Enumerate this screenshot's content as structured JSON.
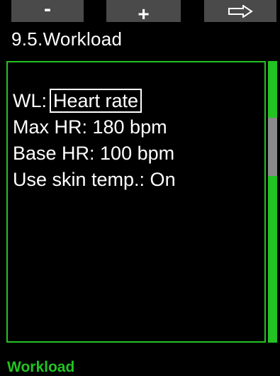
{
  "softkeys": {
    "minus_label": "-",
    "plus_label": "+",
    "next_icon": "arrow-right-icon"
  },
  "header": {
    "title": "9.5.Workload"
  },
  "settings": {
    "wl_label": "WL:",
    "wl_value": "Heart rate",
    "max_hr": "Max HR: 180 bpm",
    "base_hr": "Base HR: 100 bpm",
    "skin_temp": "Use skin temp.: On"
  },
  "footer": {
    "label": "Workload"
  },
  "colors": {
    "accent_green": "#22c322",
    "softkey_gray": "#4a4a4a",
    "scroll_thumb": "#8a8a8a",
    "background": "#000000",
    "text": "#ffffff"
  }
}
